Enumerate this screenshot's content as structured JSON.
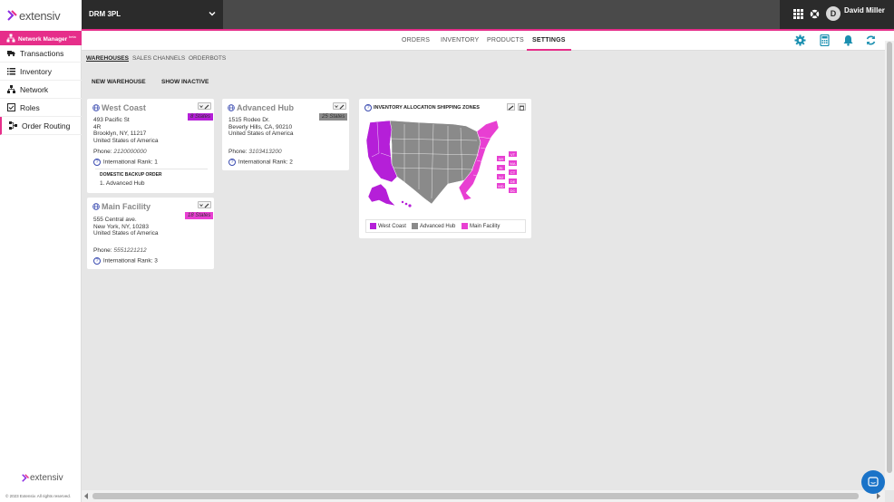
{
  "brand": {
    "logo_text": "extensiv",
    "accent": "#e62e8a"
  },
  "org_selector": {
    "label": "DRM 3PL"
  },
  "user": {
    "initial": "D",
    "name": "David Miller"
  },
  "sidebar": {
    "header": {
      "label": "Network Manager",
      "badge": "beta"
    },
    "items": [
      {
        "label": "Transactions",
        "icon": "truck-icon"
      },
      {
        "label": "Inventory",
        "icon": "list-icon"
      },
      {
        "label": "Network",
        "icon": "network-icon"
      },
      {
        "label": "Roles",
        "icon": "checklist-icon"
      },
      {
        "label": "Order Routing",
        "icon": "routing-icon"
      }
    ],
    "footer_logo": "extensiv",
    "copyright": "© 2023 Extensiv. All rights reserved."
  },
  "top_tabs": [
    {
      "label": "ORDERS"
    },
    {
      "label": "INVENTORY"
    },
    {
      "label": "PRODUCTS"
    },
    {
      "label": "SETTINGS",
      "active": true
    }
  ],
  "section_tabs": [
    {
      "label": "WAREHOUSES",
      "active": true
    },
    {
      "label": "SALES CHANNELS"
    },
    {
      "label": "ORDERBOTS"
    }
  ],
  "actions": {
    "new_warehouse": "NEW WAREHOUSE",
    "show_inactive": "SHOW INACTIVE"
  },
  "warehouses": [
    {
      "name": "West Coast",
      "states_badge": "8 States",
      "badge_color": "#b51fd8",
      "address": [
        "493 Pacific St",
        "4R",
        "Brooklyn, NY, 11217",
        "United States of America"
      ],
      "phone_label": "Phone:",
      "phone": "2120000000",
      "rank_label": "International Rank:",
      "rank": "1",
      "backup_title": "DOMESTIC BACKUP ORDER",
      "backup_items": [
        "1. Advanced Hub"
      ]
    },
    {
      "name": "Advanced Hub",
      "states_badge": "25 States",
      "badge_color": "#8a8a8a",
      "address": [
        "1515 Rodeo Dr.",
        "Beverly Hills, CA, 90210",
        "United States of America"
      ],
      "phone_label": "Phone:",
      "phone": "3103413200",
      "rank_label": "International Rank:",
      "rank": "2"
    },
    {
      "name": "Main Facility",
      "states_badge": "18 States",
      "badge_color": "#e83fd2",
      "address": [
        "555 Central ave.",
        "New York, NY, 10283",
        "United States of America"
      ],
      "phone_label": "Phone:",
      "phone": "5551221212",
      "rank_label": "International Rank:",
      "rank": "3"
    }
  ],
  "allocation_map": {
    "title": "INVENTORY ALLOCATION SHIPPING ZONES",
    "state_tags": [
      "VT",
      "NH",
      "MA",
      "RI",
      "CT",
      "NJ",
      "DE",
      "MD",
      "DC"
    ],
    "legend": [
      {
        "label": "West Coast",
        "color": "#b51fd8"
      },
      {
        "label": "Advanced Hub",
        "color": "#8a8a8a"
      },
      {
        "label": "Main Facility",
        "color": "#e83fd2"
      }
    ]
  }
}
